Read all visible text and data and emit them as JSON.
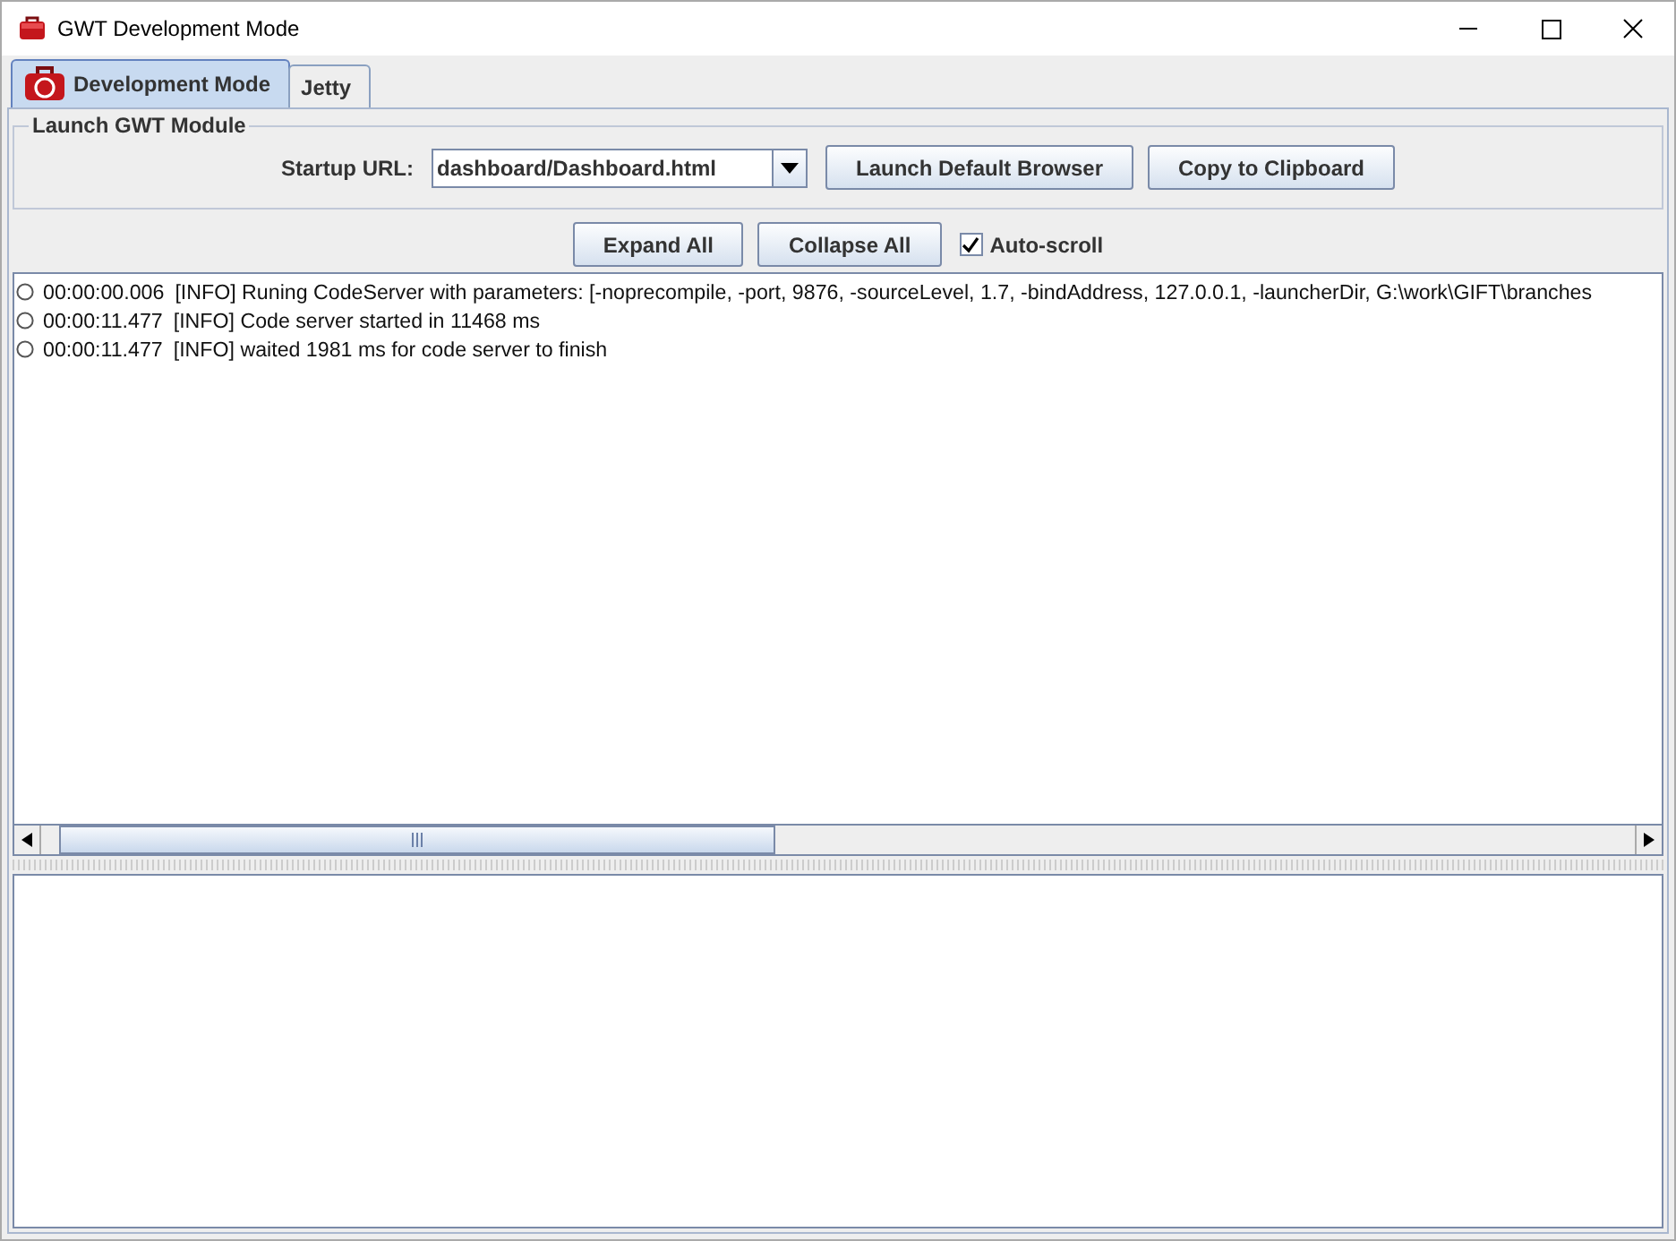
{
  "window": {
    "title": "GWT Development Mode"
  },
  "tabs": [
    {
      "label": "Development Mode",
      "selected": true,
      "icon": true
    },
    {
      "label": "Jetty",
      "selected": false,
      "icon": false
    }
  ],
  "launch_panel": {
    "title": "Launch GWT Module",
    "url_label": "Startup URL:",
    "url_value": "dashboard/Dashboard.html",
    "buttons": [
      "Launch Default Browser",
      "Copy to Clipboard"
    ]
  },
  "log_toolbar": {
    "buttons": [
      "Expand All",
      "Collapse All"
    ],
    "auto_scroll": {
      "label": "Auto-scroll",
      "checked": true
    }
  },
  "log": [
    {
      "time": "00:00:00.006",
      "message": "[INFO] Runing CodeServer with parameters: [-noprecompile, -port, 9876, -sourceLevel, 1.7, -bindAddress, 127.0.0.1, -launcherDir, G:\\work\\GIFT\\branches"
    },
    {
      "time": "00:00:11.477",
      "message": "[INFO] Code server started in 11468 ms"
    },
    {
      "time": "00:00:11.477",
      "message": "[INFO] waited 1981 ms for code server to finish"
    }
  ]
}
